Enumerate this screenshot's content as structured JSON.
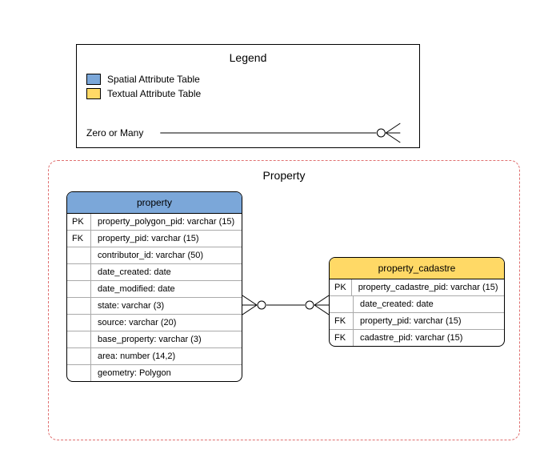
{
  "legend": {
    "title": "Legend",
    "spatial_label": "Spatial Attribute Table",
    "textual_label": "Textual Attribute Table",
    "rel_label": "Zero or Many"
  },
  "container": {
    "title": "Property"
  },
  "tables": {
    "property": {
      "name": "property",
      "rows": [
        {
          "key": "PK",
          "attr": "property_polygon_pid: varchar (15)"
        },
        {
          "key": "FK",
          "attr": "property_pid: varchar (15)"
        },
        {
          "key": "",
          "attr": "contributor_id: varchar (50)"
        },
        {
          "key": "",
          "attr": "date_created: date"
        },
        {
          "key": "",
          "attr": "date_modified: date"
        },
        {
          "key": "",
          "attr": "state: varchar (3)"
        },
        {
          "key": "",
          "attr": "source: varchar (20)"
        },
        {
          "key": "",
          "attr": "base_property: varchar (3)"
        },
        {
          "key": "",
          "attr": "area: number (14,2)"
        },
        {
          "key": "",
          "attr": "geometry: Polygon"
        }
      ]
    },
    "cadastre": {
      "name": "property_cadastre",
      "rows": [
        {
          "key": "PK",
          "attr": "property_cadastre_pid: varchar (15)"
        },
        {
          "key": "",
          "attr": "date_created: date"
        },
        {
          "key": "FK",
          "attr": "property_pid: varchar (15)"
        },
        {
          "key": "FK",
          "attr": "cadastre_pid: varchar (15)"
        }
      ]
    }
  }
}
